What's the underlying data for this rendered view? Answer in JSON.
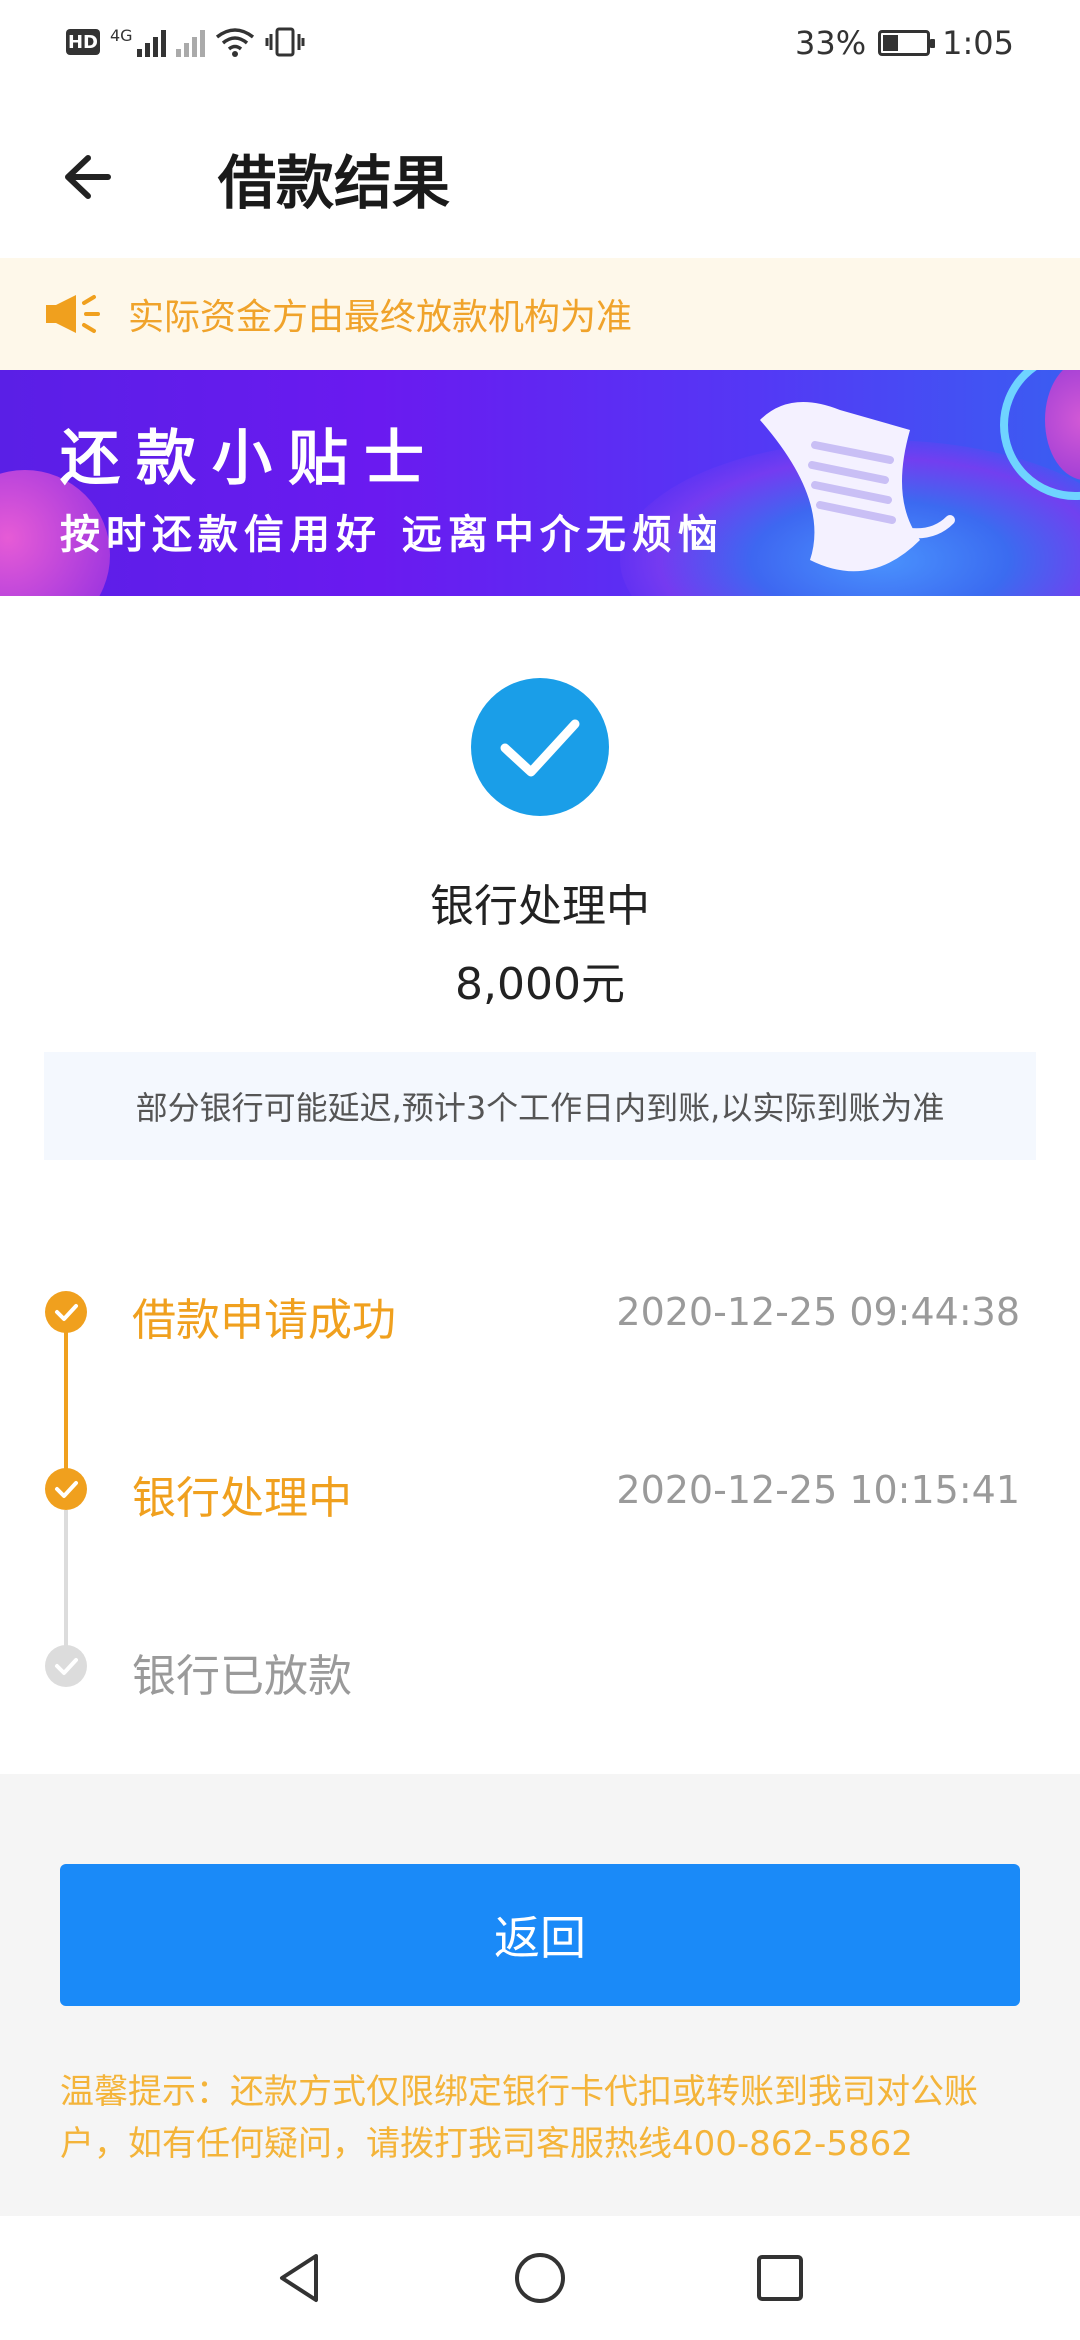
{
  "status_bar": {
    "hd": "HD",
    "network": "4G",
    "battery_percent": "33%",
    "time": "1:05"
  },
  "header": {
    "title": "借款结果",
    "back_icon": "arrow-left-icon"
  },
  "notice": {
    "text": "实际资金方由最终放款机构为准",
    "icon": "megaphone-icon"
  },
  "banner": {
    "title": "还款小贴士",
    "subtitle": "按时还款信用好 远离中介无烦恼"
  },
  "result": {
    "status": "银行处理中",
    "amount": "8,000元",
    "delay_note": "部分银行可能延迟,预计3个工作日内到账,以实际到账为准"
  },
  "timeline": [
    {
      "label": "借款申请成功",
      "time": "2020-12-25 09:44:38",
      "done": true
    },
    {
      "label": "银行处理中",
      "time": "2020-12-25 10:15:41",
      "done": true
    },
    {
      "label": "银行已放款",
      "time": "",
      "done": false
    }
  ],
  "colors": {
    "accent_orange": "#f0a01e",
    "primary_blue": "#1a8af8",
    "check_blue": "#1a9ee8",
    "pending_gray": "#d8d8d8"
  },
  "footer": {
    "return_label": "返回",
    "tip": "温馨提示：还款方式仅限绑定银行卡代扣或转账到我司对公账户，如有任何疑问，请拨打我司客服热线400-862-5862"
  }
}
